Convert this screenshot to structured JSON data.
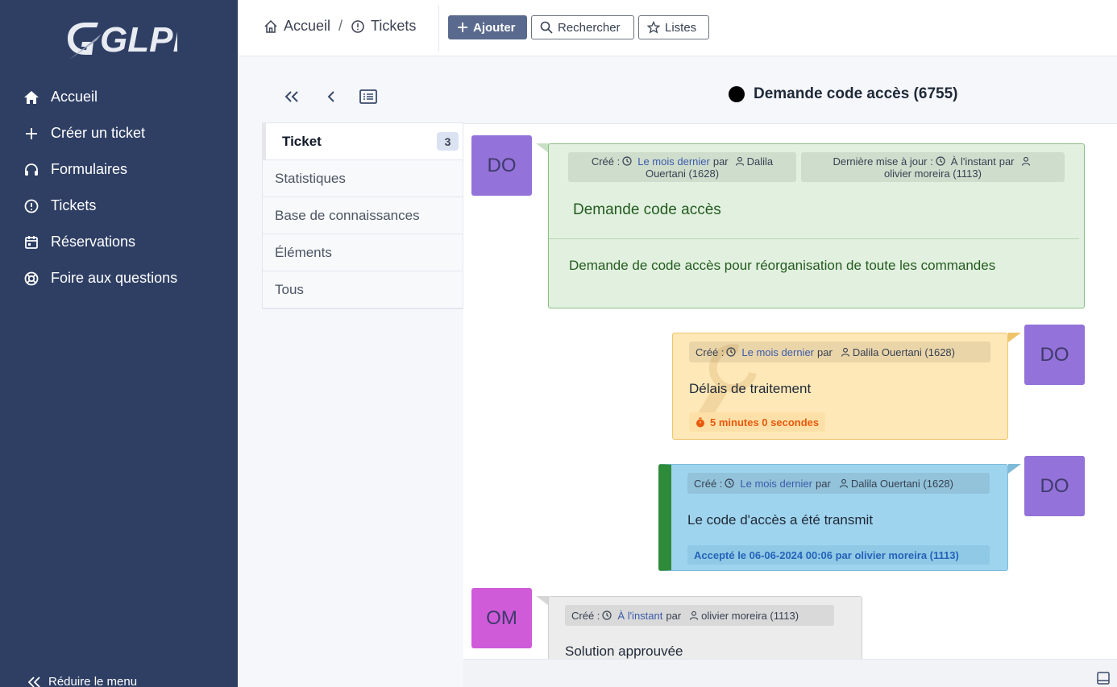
{
  "app": {
    "logo_text": "GLPI"
  },
  "sidebar": {
    "items": [
      {
        "label": "Accueil",
        "icon": "home-icon"
      },
      {
        "label": "Créer un ticket",
        "icon": "plus-icon"
      },
      {
        "label": "Formulaires",
        "icon": "headset-icon"
      },
      {
        "label": "Tickets",
        "icon": "alert-circle-icon"
      },
      {
        "label": "Réservations",
        "icon": "calendar-icon"
      },
      {
        "label": "Foire aux questions",
        "icon": "lifebuoy-icon"
      }
    ],
    "collapse_label": "Réduire le menu"
  },
  "header": {
    "breadcrumb": {
      "home": "Accueil",
      "separator": "/",
      "section": "Tickets"
    },
    "buttons": {
      "add": "Ajouter",
      "search": "Rechercher",
      "lists": "Listes"
    }
  },
  "ticket": {
    "title": "Demande code accès (6755)",
    "status_color": "#000000"
  },
  "tabs": [
    {
      "label": "Ticket",
      "badge": "3"
    },
    {
      "label": "Statistiques"
    },
    {
      "label": "Base de connaissances"
    },
    {
      "label": "Éléments"
    },
    {
      "label": "Tous"
    }
  ],
  "timeline": {
    "main": {
      "avatar": "DO",
      "created_prefix": "Créé :",
      "created_when": "Le mois dernier",
      "by": "par",
      "created_author_1": "Dalila",
      "created_author_2": "Ouertani (1628)",
      "updated_prefix": "Dernière mise à jour :",
      "updated_when": "À l'instant",
      "updated_author_1": "",
      "updated_author_2": "olivier moreira (1113)",
      "title": "Demande code accès",
      "content": "Demande de code accès pour réorganisation de toute les commandes"
    },
    "task": {
      "avatar": "DO",
      "created_prefix": "Créé :",
      "created_when": "Le mois dernier",
      "by": "par",
      "author": "Dalila Ouertani (1628)",
      "content": "Délais de traitement",
      "duration": "5 minutes 0 secondes"
    },
    "solution": {
      "avatar": "DO",
      "created_prefix": "Créé :",
      "created_when": "Le mois dernier",
      "by": "par",
      "author": "Dalila Ouertani (1628)",
      "content": "Le code d'accès a été transmit",
      "accepted": "Accepté le 06-06-2024 00:06 par olivier moreira (1113)"
    },
    "followup": {
      "avatar": "OM",
      "created_prefix": "Créé :",
      "created_when": "À l'instant",
      "by": "par",
      "author": "olivier moreira (1113)",
      "content": "Solution approuvée"
    }
  },
  "colors": {
    "sidebar_bg": "#2f3f64",
    "primary_button": "#5a6a8e",
    "card_main": "#e1f0df",
    "card_task": "#fee8b8",
    "card_solution": "#9fd4ee",
    "solution_accent": "#2e8b3a",
    "avatar_do": "#9372d9",
    "avatar_om": "#cf5bd9"
  }
}
